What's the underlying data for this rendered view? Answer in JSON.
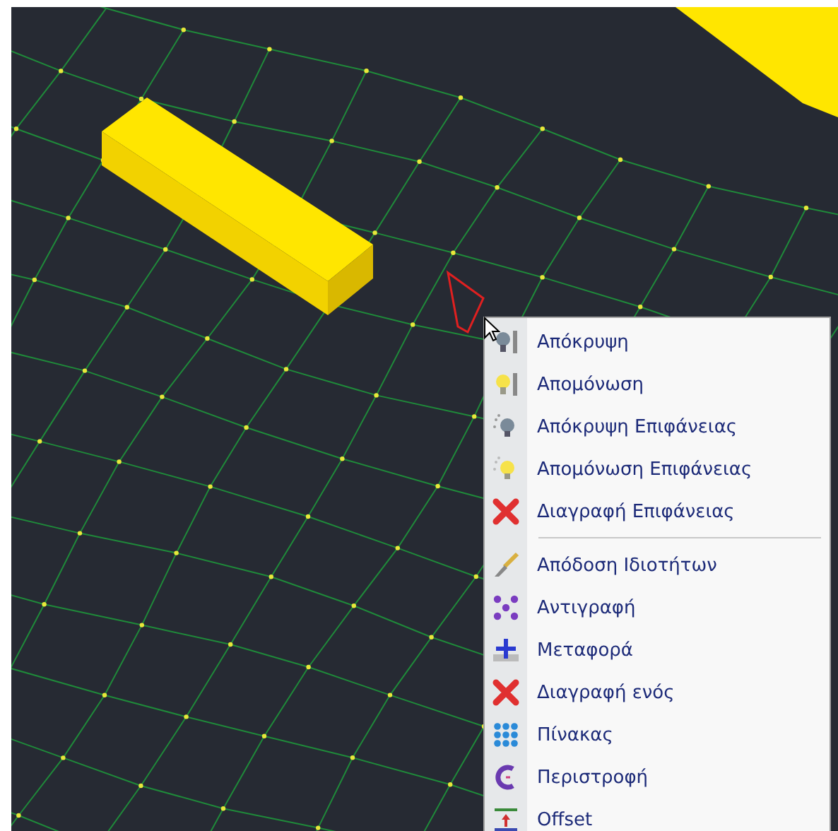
{
  "context_menu": {
    "items": [
      {
        "kind": "hide",
        "label": "Απόκρυψη"
      },
      {
        "kind": "isolate",
        "label": "Απομόνωση"
      },
      {
        "kind": "hide-surface",
        "label": "Απόκρυψη Επιφάνειας"
      },
      {
        "kind": "isolate-surface",
        "label": "Απομόνωση Επιφάνειας"
      },
      {
        "kind": "delete",
        "label": "Διαγραφή Επιφάνειας"
      },
      {
        "kind": "separator"
      },
      {
        "kind": "brush",
        "label": "Απόδοση Ιδιοτήτων"
      },
      {
        "kind": "copy",
        "label": "Αντιγραφή"
      },
      {
        "kind": "move",
        "label": "Μεταφορά"
      },
      {
        "kind": "delete",
        "label": "Διαγραφή ενός"
      },
      {
        "kind": "array",
        "label": "Πίνακας"
      },
      {
        "kind": "rotate",
        "label": "Περιστροφή"
      },
      {
        "kind": "offset",
        "label": "Offset"
      }
    ]
  }
}
